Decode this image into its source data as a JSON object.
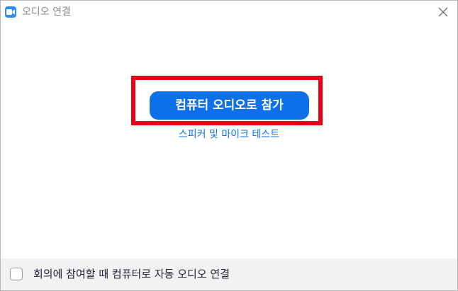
{
  "window": {
    "title": "오디오 연결",
    "app_icon": "zoom-camera-icon",
    "close_icon": "close-icon"
  },
  "main": {
    "join_button_label": "컴퓨터 오디오로 참가",
    "test_link_label": "스피커 및 마이크 테스트"
  },
  "footer": {
    "auto_join_checked": false,
    "auto_join_label": "회의에 참여할 때 컴퓨터로 자동 오디오 연결"
  },
  "colors": {
    "accent": "#0e71eb",
    "highlight": "#e8001b",
    "app_icon": "#2d8cff",
    "footer_bg": "#f2f2f2"
  }
}
